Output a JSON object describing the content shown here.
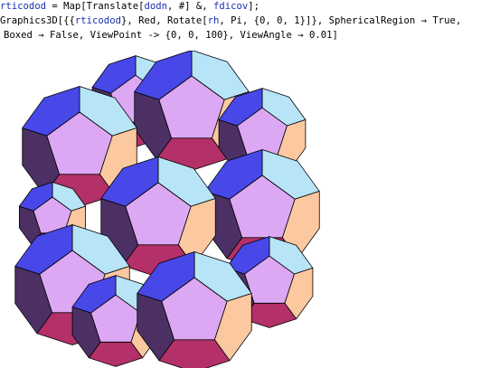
{
  "notebook": {
    "input_lines": [
      {
        "segments": [
          {
            "text": "rticodod",
            "style": "var"
          },
          {
            "text": " = Map[Translate[",
            "style": "plain"
          },
          {
            "text": "dodn",
            "style": "var"
          },
          {
            "text": ", #] &, ",
            "style": "plain"
          },
          {
            "text": "fdicov",
            "style": "var"
          },
          {
            "text": "];",
            "style": "plain"
          }
        ]
      },
      {
        "segments": [
          {
            "text": "Graphics3D[{{",
            "style": "plain"
          },
          {
            "text": "rticodod",
            "style": "var"
          },
          {
            "text": "}, Red, Rotate[",
            "style": "plain"
          },
          {
            "text": "rh",
            "style": "var"
          },
          {
            "text": ", Pi, {0, 0, 1}]}, SphericalRegion → True,",
            "style": "plain"
          }
        ]
      },
      {
        "segments": [
          {
            "text": "Boxed → False, ViewPoint -> {0, 0, 100}, ViewAngle → 0.01]",
            "style": "plain"
          }
        ]
      }
    ]
  },
  "graphics": {
    "colors": {
      "top": "#dca8f4",
      "left": "#4848e8",
      "upper": "#b8e4f8",
      "right": "#fcc8a0",
      "lowerRight": "#b43068",
      "lowerLeft": "#4c3064",
      "edge": "#000000"
    }
  }
}
